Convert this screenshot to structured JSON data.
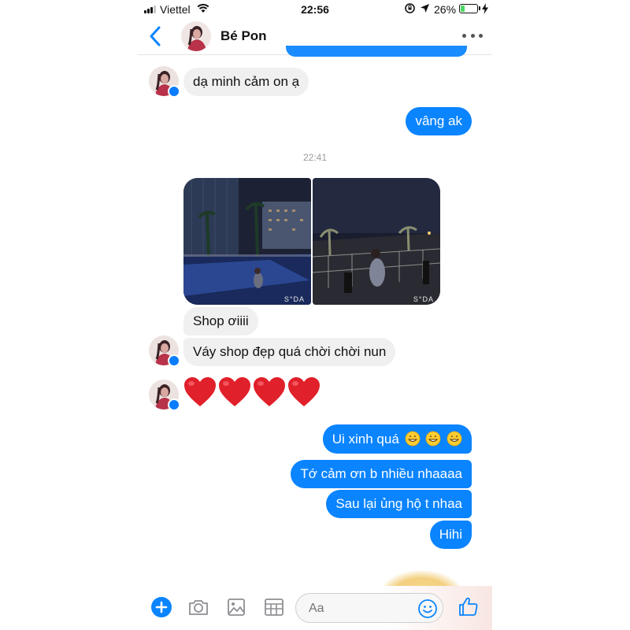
{
  "status_bar": {
    "carrier": "Viettel",
    "time": "22:56",
    "battery": "26%",
    "battery_level": 0.26
  },
  "header": {
    "contact_name": "Bé Pon"
  },
  "timestamp": "22:41",
  "messages": {
    "m1": "dạ minh cảm on ạ",
    "m2": "vâng ak",
    "m3": "Shop ơiiii",
    "m4": "Váy shop đẹp quá chời chời nun",
    "m6": "Ui xinh quá",
    "m7": "Tớ cảm ơn b nhiều nhaaaa",
    "m8": "Sau lại ủng hộ t nhaa",
    "m9": "Hihi"
  },
  "photos": {
    "watermark": "S°DA"
  },
  "composer": {
    "placeholder": "Aa"
  },
  "colors": {
    "accent": "#0a84ff",
    "incoming_bubble": "#f0f0f0",
    "heart": "#e0202a"
  },
  "icons": [
    "back-chevron-icon",
    "more-dots-icon",
    "messenger-badge-icon",
    "plus-icon",
    "camera-icon",
    "gallery-icon",
    "sticker-icon",
    "smiley-icon",
    "thumbs-up-icon",
    "heart-icon",
    "grin-emoji-icon"
  ]
}
